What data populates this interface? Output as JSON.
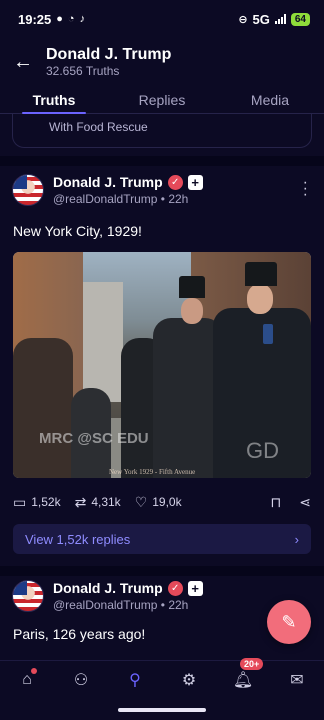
{
  "status": {
    "time": "19:25",
    "network": "5G",
    "battery": "64"
  },
  "header": {
    "title": "Donald J. Trump",
    "subtitle": "32.656 Truths"
  },
  "tabs": [
    {
      "label": "Truths"
    },
    {
      "label": "Replies"
    },
    {
      "label": "Media"
    }
  ],
  "prev_post": {
    "text": "With Food Rescue"
  },
  "posts": [
    {
      "name": "Donald J. Trump",
      "handle": "@realDonaldTrump • 22h",
      "text": "New York City, 1929!",
      "media": {
        "watermark_left": "MRC @SC EDU",
        "watermark_right": "GD",
        "caption": "New York 1929 - Fifth Avenue"
      },
      "counts": {
        "replies": "1,52k",
        "retruths": "4,31k",
        "likes": "19,0k"
      },
      "view_replies": "View 1,52k replies"
    },
    {
      "name": "Donald J. Trump",
      "handle": "@realDonaldTrump • 22h",
      "text": "Paris, 126 years ago!"
    }
  ],
  "nav": {
    "notifications_badge": "20+"
  },
  "colors": {
    "background": "#0c0a24",
    "accent": "#6b63ff",
    "fab": "#f26d7b",
    "badge": "#e54a5a"
  }
}
